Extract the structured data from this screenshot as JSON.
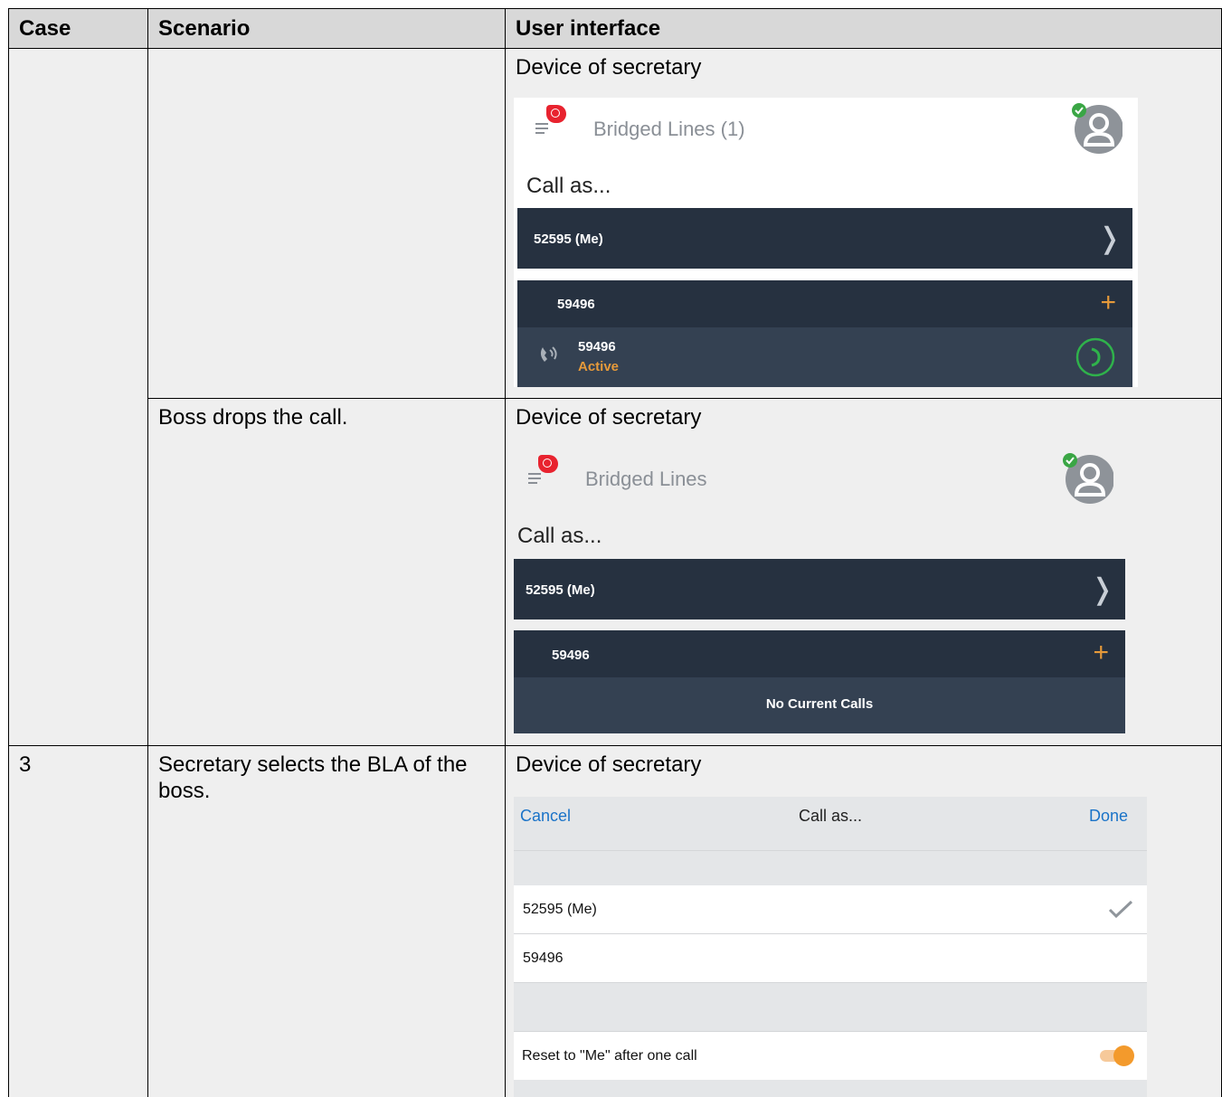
{
  "table": {
    "headers": {
      "case": "Case",
      "scenario": "Scenario",
      "ui": "User interface"
    },
    "rows": [
      {
        "case": "",
        "scenario": "",
        "ui_caption": "Device of secretary"
      },
      {
        "case": "",
        "scenario": "Boss drops the call.",
        "ui_caption": "Device of secretary"
      },
      {
        "case": "3",
        "scenario": "Secretary selects the BLA of the boss.",
        "ui_caption": "Device of secretary"
      }
    ]
  },
  "screens": {
    "one": {
      "title": "Bridged Lines (1)",
      "call_as": "Call as...",
      "me_line": "52595 (Me)",
      "bla_line": "59496",
      "call_number": "59496",
      "call_status": "Active"
    },
    "two": {
      "title": "Bridged Lines",
      "call_as": "Call as...",
      "me_line": "52595 (Me)",
      "bla_line": "59496",
      "empty_text": "No Current Calls"
    },
    "three": {
      "cancel": "Cancel",
      "title": "Call as...",
      "done": "Done",
      "option_me": "52595 (Me)",
      "option_bla": "59496",
      "reset_label": "Reset to \"Me\" after one call",
      "reset_on": true
    }
  },
  "colors": {
    "dark_row": "#263140",
    "active_orange": "#e69a3a",
    "call_green": "#2fb24b",
    "presence_green": "#3aa645",
    "badge_red": "#e8232f",
    "link_blue": "#1a73c8",
    "toggle_orange": "#f39a2c"
  },
  "icons": [
    "menu-icon",
    "notification-badge-icon",
    "avatar-icon",
    "presence-check-icon",
    "chevron-right-icon",
    "plus-icon",
    "bridged-call-icon",
    "phone-icon",
    "checkmark-icon",
    "toggle-switch"
  ]
}
